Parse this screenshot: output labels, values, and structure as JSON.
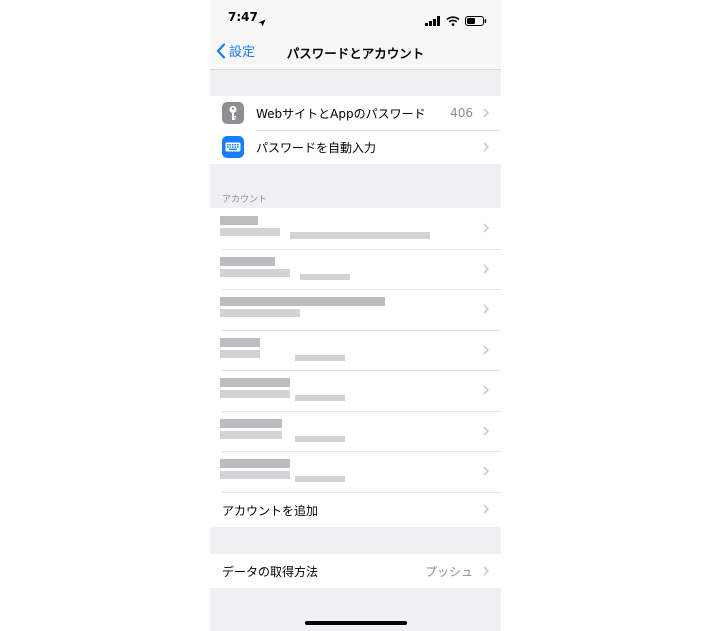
{
  "status": {
    "time": "7:47"
  },
  "nav": {
    "back_label": "設定",
    "title": "パスワードとアカウント"
  },
  "passwords": {
    "items": [
      {
        "label": "WebサイトとAppのパスワード",
        "value": "406",
        "icon": "key-icon",
        "color": "#8e8e93"
      },
      {
        "label": "パスワードを自動入力",
        "value": "",
        "icon": "keyboard-icon",
        "color": "#157efb"
      }
    ]
  },
  "accounts": {
    "header": "アカウント",
    "add_label": "アカウントを追加"
  },
  "fetch": {
    "label": "データの取得方法",
    "value": "プッシュ"
  }
}
